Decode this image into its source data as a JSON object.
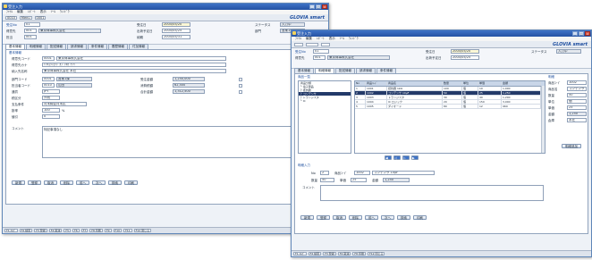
{
  "colors": {
    "titlebar": "#2d5fb3",
    "accent": "#1d4f9e",
    "selected_row": "#233a69",
    "brand": "#1f4fa0"
  },
  "back_window": {
    "title": "受注入力",
    "title_buttons": [
      "_",
      "□",
      "×"
    ],
    "menu": [
      "ﾌｧｲﾙ",
      "編集",
      "ﾚﾎﾟｰﾄ",
      "表示",
      "ﾂｰﾙ",
      "ｳｨﾝﾄﾞｳ"
    ],
    "toolbar": {
      "user_field": "0010",
      "menu_field": "Menu",
      "period_field": "0001"
    },
    "brand": "GLOVIA smart",
    "header": {
      "order_no_label": "受注No",
      "order_no": "01",
      "customer_label": "得意先",
      "customer": "001",
      "customer_name": "東京商事株式会社",
      "staff_label": "担当",
      "staff": "001",
      "order_date_label": "受注日",
      "order_date": "2004/05/20",
      "ship_date_label": "出荷予定日",
      "ship_date": "2004/05/25",
      "delivery_date_label": "納期",
      "delivery_date": "2004/05/31",
      "status_label": "ステータス",
      "status_value": "入力中",
      "dept_label": "部門",
      "dept_value": "営業1課"
    },
    "tabs": [
      "基本情報",
      "明細情報",
      "配送情報",
      "請求情報",
      "条件情報",
      "履歴情報",
      "付加情報"
    ],
    "section_title": "基本情報",
    "rows": {
      "customer_code_label": "得意先コード",
      "customer_code": "0001",
      "customer_name": "東京商事株式会社",
      "customer_kana_label": "得意先カナ",
      "customer_kana": "ﾄｳｷｮｳｼｮｳｼﾞｶﾌﾞｼｷｶﾞｲｼｬ",
      "ship_to_label": "納入先名称",
      "ship_to": "東京商事株式会社 本社",
      "dept_code_label": "部門コード",
      "dept_code": "0001",
      "dept_name": "営業1課",
      "staff_code_label": "担当者コード",
      "staff_code": "0010",
      "staff_name": "山田",
      "currency_label": "通貨",
      "currency": "JPY",
      "tax_label": "税区分",
      "tax": "外税",
      "payment_label": "支払条件",
      "payment": "月末締翌月末払",
      "order_amount_label": "受注金額",
      "order_amount": "1,250,000",
      "tax_amount_label": "消費税額",
      "tax_amount": "62,500",
      "total_label": "合計金額",
      "total": "1,312,500",
      "rate_label": "掛率",
      "rate": "100",
      "percent": "%",
      "discount_label": "値引",
      "discount": "0",
      "memo_label": "コメント",
      "memo": "特記事項なし"
    },
    "buttons": [
      "新規",
      "登録",
      "取消",
      "削除",
      "前へ",
      "次へ",
      "検索",
      "印刷"
    ],
    "status_bar": [
      "F1 ﾍﾙﾌﾟ",
      "F2 検索",
      "F3 登録",
      "F4 取消",
      "F5 ",
      "F6 ",
      "F7 ",
      "F8 印刷",
      "F9 ",
      "F10 ",
      "F11 ",
      "F12 閉じる"
    ]
  },
  "front_window": {
    "title": "受注入力",
    "title_buttons": [
      "_",
      "□",
      "×"
    ],
    "menu": [
      "ﾌｧｲﾙ",
      "編集",
      "ﾚﾎﾟｰﾄ",
      "表示",
      "ﾂｰﾙ",
      "ｳｨﾝﾄﾞｳ"
    ],
    "brand": "GLOVIA smart",
    "header": {
      "order_no_label": "受注No",
      "order_no": "01",
      "customer_label": "得意先",
      "customer": "001",
      "customer_name": "東京商事株式会社",
      "order_date_label": "受注日",
      "order_date": "2004/05/20",
      "ship_date_label": "出荷予定日",
      "ship_date": "2004/05/25",
      "status_label": "ステータス",
      "status_value": "入力中"
    },
    "tabs": [
      "基本情報",
      "明細情報",
      "配送情報",
      "請求情報",
      "条件情報"
    ],
    "tree_title": "商品一覧",
    "tree_items": [
      "商品分類",
      "└ 電子部品",
      "  ├ 抵抗器",
      "  ├ コンデンサ",
      "  ├ トランジスタ",
      "  └ IC"
    ],
    "grid": {
      "headers": [
        "No",
        "商品ｺｰﾄﾞ",
        "商品名",
        "数量",
        "単位",
        "単価",
        "金額"
      ],
      "rows": [
        [
          "1",
          "1001",
          "抵抗器 1kΩ",
          "100",
          "個",
          "10",
          "1,000"
        ],
        [
          "2",
          "1002",
          "コンデンサ 10μF",
          "50",
          "個",
          "25",
          "1,250"
        ],
        [
          "3",
          "1003",
          "トランジスタ",
          "30",
          "個",
          "40",
          "1,200"
        ],
        [
          "4",
          "1004",
          "IC ロジック",
          "20",
          "個",
          "150",
          "3,000"
        ],
        [
          "5",
          "1005",
          "ダイオード",
          "80",
          "個",
          "12",
          "960"
        ]
      ],
      "selected_row": 1
    },
    "right_panel": {
      "title": "明細",
      "labels": [
        "商品ｺｰﾄﾞ",
        "商品名",
        "数量",
        "単位",
        "単価",
        "金額",
        "倉庫"
      ],
      "values": [
        "1002",
        "コンデンサ",
        "50",
        "個",
        "25",
        "1,250",
        "本社"
      ],
      "button": "明細追加"
    },
    "detail": {
      "section_title": "明細入力",
      "no_label": "No",
      "no": "2",
      "item_label": "商品ｺｰﾄﾞ",
      "item": "1002",
      "item_name": "コンデンサ 10μF",
      "qty_label": "数量",
      "qty": "50",
      "price_label": "単価",
      "price": "25",
      "amount_label": "金額",
      "amount": "1,250",
      "memo_label": "コメント"
    },
    "buttons": [
      "新規",
      "登録",
      "取消",
      "削除",
      "前へ",
      "次へ",
      "検索",
      "印刷"
    ],
    "status_bar": [
      "F1 ﾍﾙﾌﾟ",
      "F2 検索",
      "F3 登録",
      "F4 取消",
      "F8 印刷",
      "F12 閉じる"
    ]
  }
}
